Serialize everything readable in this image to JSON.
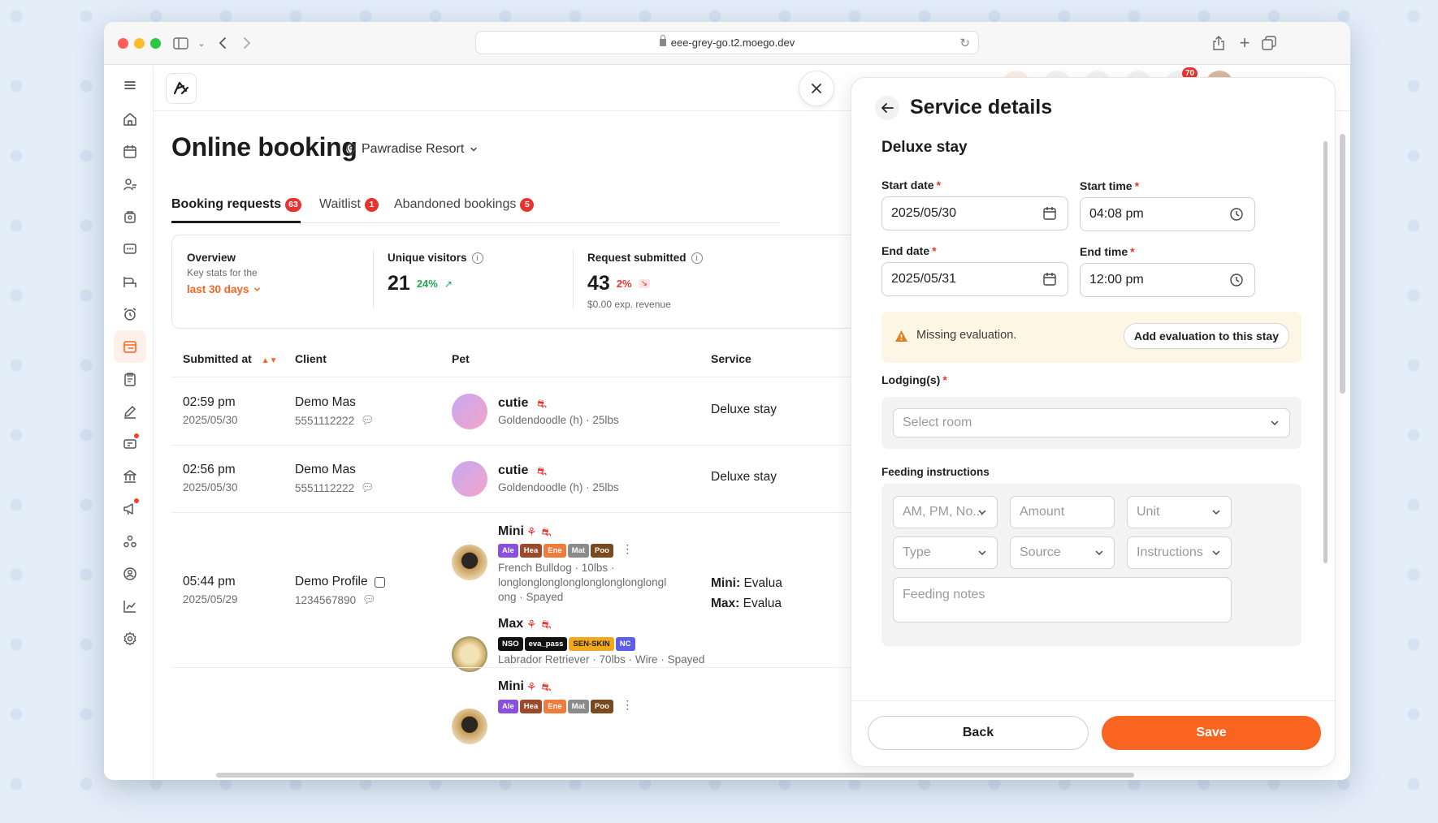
{
  "browser": {
    "url": "eee-grey-go.t2.moego.dev"
  },
  "topbar": {
    "notification_count": "70"
  },
  "page": {
    "title": "Online booking",
    "location": "Pawradise Resort"
  },
  "tabs": [
    {
      "label": "Booking requests",
      "count": "63"
    },
    {
      "label": "Waitlist",
      "count": "1"
    },
    {
      "label": "Abandoned bookings",
      "count": "5"
    }
  ],
  "stats": {
    "overview_title": "Overview",
    "overview_sub": "Key stats for the",
    "range": "last 30 days",
    "visitors_title": "Unique visitors",
    "visitors_value": "21",
    "visitors_change": "24%",
    "requests_title": "Request submitted",
    "requests_value": "43",
    "requests_change": "2%",
    "revenue": "$0.00 exp. revenue"
  },
  "table": {
    "headers": [
      "Submitted at",
      "Client",
      "Pet",
      "Service"
    ],
    "rows": [
      {
        "time": "02:59 pm",
        "date": "2025/05/30",
        "client": "Demo Mas",
        "phone": "5551112222",
        "pet": "cutie",
        "pet_info": "Goldendoodle (h) · 25lbs",
        "service": "Deluxe stay"
      },
      {
        "time": "02:56 pm",
        "date": "2025/05/30",
        "client": "Demo Mas",
        "phone": "5551112222",
        "pet": "cutie",
        "pet_info": "Goldendoodle (h) · 25lbs",
        "service": "Deluxe stay"
      },
      {
        "time": "05:44 pm",
        "date": "2025/05/29",
        "client": "Demo Profile",
        "phone": "1234567890",
        "pet1": "Mini",
        "pet1_info_1": "French Bulldog · 10lbs ·",
        "pet1_info_2": "longlonglonglonglonglonglonglongl",
        "pet1_info_3": "ong · Spayed",
        "pet1_tags": [
          "Ale",
          "Hea",
          "Ene",
          "Mat",
          "Poo"
        ],
        "pet2": "Max",
        "pet2_info": "Labrador Retriever · 70lbs · Wire · Spayed",
        "pet2_tags": [
          "NSO",
          "eva_pass",
          "SEN-SKIN",
          "NC"
        ],
        "service1_label": "Mini:",
        "service1_value": "Evalua",
        "service2_label": "Max:",
        "service2_value": "Evalua"
      },
      {
        "pet": "Mini",
        "pet_tags": [
          "Ale",
          "Hea",
          "Ene",
          "Mat",
          "Poo"
        ]
      }
    ]
  },
  "panel": {
    "title": "Service details",
    "service_name": "Deluxe stay",
    "start_date_label": "Start date",
    "start_date": "2025/05/30",
    "start_time_label": "Start time",
    "start_time": "04:08 pm",
    "end_date_label": "End date",
    "end_date": "2025/05/31",
    "end_time_label": "End time",
    "end_time": "12:00 pm",
    "warning": "Missing evaluation.",
    "warning_action": "Add evaluation to this stay",
    "lodging_label": "Lodging(s)",
    "lodging_placeholder": "Select room",
    "feeding_label": "Feeding instructions",
    "feeding_schedule_ph": "AM, PM, No...",
    "feeding_amount_ph": "Amount",
    "feeding_unit_ph": "Unit",
    "feeding_type_ph": "Type",
    "feeding_source_ph": "Source",
    "feeding_instructions_ph": "Instructions",
    "feeding_notes_ph": "Feeding notes",
    "back_label": "Back",
    "save_label": "Save"
  },
  "colors": {
    "accent": "#f96421",
    "badge": "#e8342e",
    "positive": "#1faa55",
    "tag_ale": "#8a4fe0",
    "tag_hea": "#9c4a2a",
    "tag_ene": "#f07b3a",
    "tag_mat": "#8b8b8b",
    "tag_poo": "#7a4a1e",
    "tag_nso": "#111111",
    "tag_sen": "#f2a81d",
    "tag_nc": "#5b5fe8"
  }
}
